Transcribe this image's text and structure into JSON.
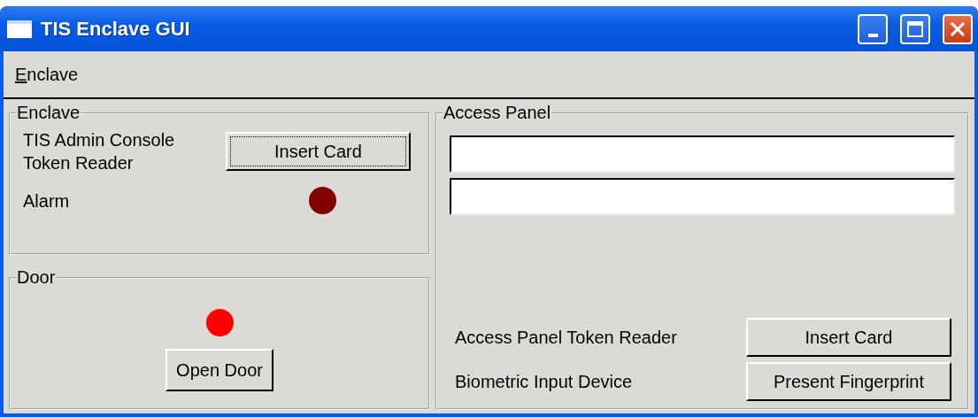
{
  "window": {
    "title": "TIS Enclave GUI"
  },
  "menu": [
    {
      "label": "Enclave",
      "initial_underlined": true
    }
  ],
  "enclave_group": {
    "title": "Enclave",
    "rows": [
      {
        "kind": "button",
        "label": "TIS Admin Console Token Reader",
        "button": "Insert Card",
        "focused": true
      },
      {
        "kind": "light",
        "label": "Alarm",
        "color": "#800000"
      }
    ]
  },
  "door_group": {
    "title": "Door",
    "light": {
      "color": "#ff0000"
    },
    "button": "Open Door"
  },
  "access_panel": {
    "title": "Access Panel",
    "displays": [
      {
        "kind": "line"
      },
      {
        "kind": "line"
      }
    ],
    "rows": [
      {
        "label": "Access Panel Token Reader",
        "button": "Insert Card"
      },
      {
        "label": "Biometric Input Device",
        "button": "Present Fingerprint"
      }
    ]
  }
}
